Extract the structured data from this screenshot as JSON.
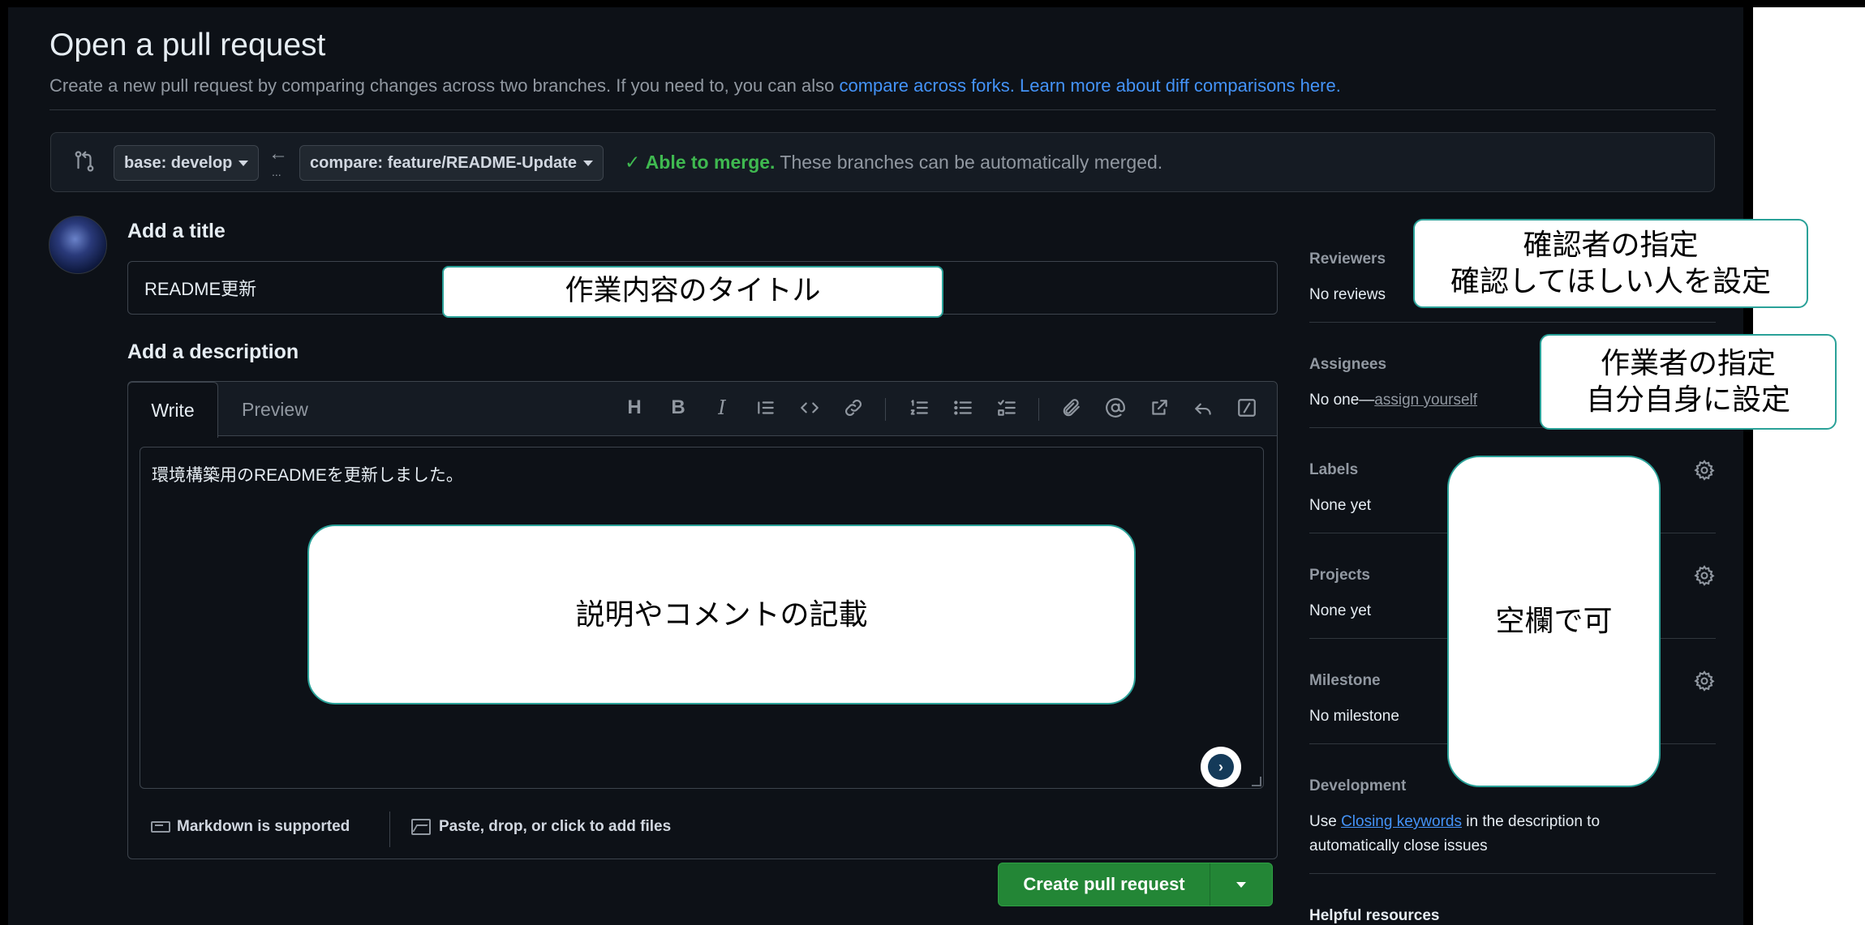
{
  "header": {
    "title": "Open a pull request",
    "subtitle_text": "Create a new pull request by comparing changes across two branches. If you need to, you can also ",
    "subtitle_link1": "compare across forks.",
    "subtitle_link2": "Learn more about diff comparisons here."
  },
  "compare_bar": {
    "base_label": "base: develop",
    "arrow": "←",
    "arrow_dots": "...",
    "compare_label": "compare: feature/README-Update",
    "merge_ok": "Able to merge.",
    "merge_text": " These branches can be automatically merged."
  },
  "title_section": {
    "label": "Add a title",
    "value": "README更新"
  },
  "description": {
    "label": "Add a description",
    "tab_write": "Write",
    "tab_preview": "Preview",
    "toolbar": {
      "heading": "H",
      "bold": "B",
      "italic": "I"
    },
    "body_text": "環境構築用のREADMEを更新しました。",
    "markdown_note": "Markdown is supported",
    "attach_note": "Paste, drop, or click to add files"
  },
  "actions": {
    "create_label": "Create pull request"
  },
  "sidebar": {
    "reviewers": {
      "title": "Reviewers",
      "value": "No reviews"
    },
    "assignees": {
      "title": "Assignees",
      "value_prefix": "No one—",
      "value_link": "assign yourself"
    },
    "labels": {
      "title": "Labels",
      "value": "None yet"
    },
    "projects": {
      "title": "Projects",
      "value": "None yet"
    },
    "milestone": {
      "title": "Milestone",
      "value": "No milestone"
    },
    "development": {
      "title": "Development",
      "text_prefix": "Use ",
      "link": "Closing keywords",
      "text_suffix": " in the description to automatically close issues"
    },
    "helpful": {
      "title": "Helpful resources"
    }
  },
  "annotations": {
    "title_note": "作業内容のタイトル",
    "description_note": "説明やコメントの記載",
    "reviewers_note_1": "確認者の指定",
    "reviewers_note_2": "確認してほしい人を設定",
    "assignees_note_1": "作業者の指定",
    "assignees_note_2": "自分自身に設定",
    "optional_note": "空欄で可"
  },
  "colors": {
    "background": "#0d1117",
    "accent_link": "#4493f8",
    "success": "#3fb950",
    "primary_button": "#238636",
    "callout_border": "#2aa198"
  }
}
